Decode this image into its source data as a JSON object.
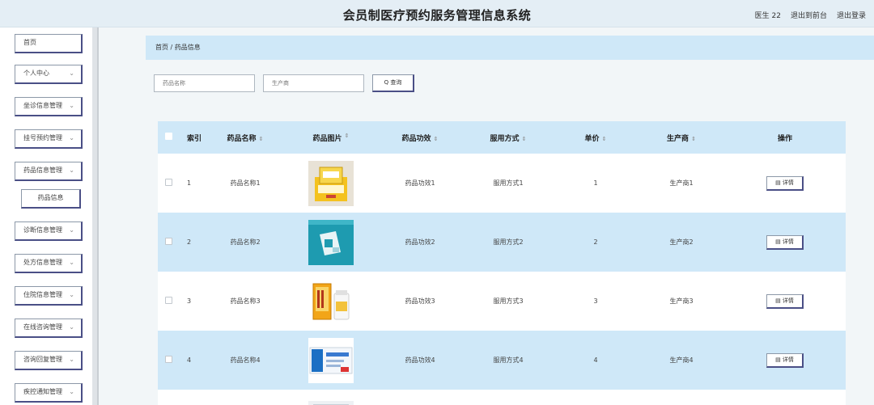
{
  "header": {
    "title": "会员制医疗预约服务管理信息系统",
    "user": "医生 22",
    "to_front": "退出到前台",
    "logout": "退出登录"
  },
  "sidebar": {
    "items": [
      {
        "label": "首页",
        "chevron": false
      },
      {
        "label": "个人中心",
        "chevron": true
      },
      {
        "label": "坐诊信息管理",
        "chevron": true
      },
      {
        "label": "挂号预约管理",
        "chevron": true
      },
      {
        "label": "药品信息管理",
        "chevron": true
      },
      {
        "label": "药品信息",
        "chevron": false
      },
      {
        "label": "诊断信息管理",
        "chevron": true
      },
      {
        "label": "处方信息管理",
        "chevron": true
      },
      {
        "label": "住院信息管理",
        "chevron": true
      },
      {
        "label": "在线咨询管理",
        "chevron": true
      },
      {
        "label": "咨询回复管理",
        "chevron": true
      },
      {
        "label": "疾控通知管理",
        "chevron": true
      }
    ]
  },
  "breadcrumb": "首页 / 药品信息",
  "search": {
    "name_placeholder": "药品名称",
    "maker_placeholder": "生产商",
    "button_label": "Q 查询"
  },
  "table": {
    "columns": {
      "idx": "索引",
      "name": "药品名称",
      "image": "药品图片",
      "effect": "药品功效",
      "usage": "服用方式",
      "price": "单价",
      "maker": "生产商",
      "op": "操作"
    },
    "sort_glyph": "⇕",
    "detail_label": "▤ 详情",
    "rows": [
      {
        "index": "1",
        "name": "药品名称1",
        "effect": "药品功效1",
        "usage": "服用方式1",
        "price": "1",
        "maker": "生产商1"
      },
      {
        "index": "2",
        "name": "药品名称2",
        "effect": "药品功效2",
        "usage": "服用方式2",
        "price": "2",
        "maker": "生产商2"
      },
      {
        "index": "3",
        "name": "药品名称3",
        "effect": "药品功效3",
        "usage": "服用方式3",
        "price": "3",
        "maker": "生产商3"
      },
      {
        "index": "4",
        "name": "药品名称4",
        "effect": "药品功效4",
        "usage": "服用方式4",
        "price": "4",
        "maker": "生产商4"
      }
    ]
  },
  "colors": {
    "accent": "#cfe8f8",
    "border_dark": "#4a4f86"
  }
}
